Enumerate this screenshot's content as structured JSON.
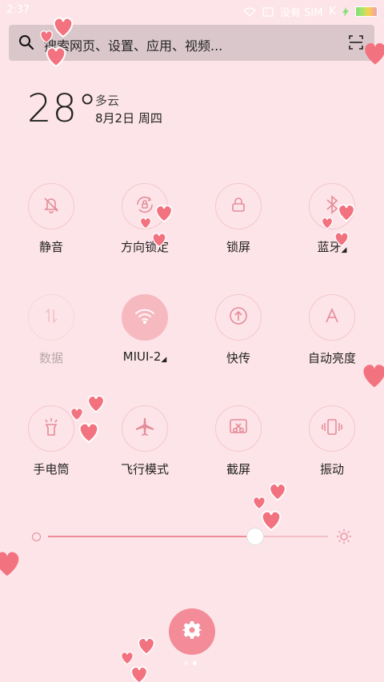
{
  "status_bar": {
    "time": "2:37",
    "carrier": "没有 SIM",
    "speed": "K"
  },
  "search": {
    "placeholder": "搜索网页、设置、应用、视频..."
  },
  "weather": {
    "temperature": "28°",
    "condition": "多云",
    "date": "8月2日 周四"
  },
  "toggles": [
    {
      "label": "静音",
      "icon": "bell-off-icon",
      "state": "off"
    },
    {
      "label": "方向锁定",
      "icon": "rotation-lock-icon",
      "state": "off"
    },
    {
      "label": "锁屏",
      "icon": "lock-icon",
      "state": "off"
    },
    {
      "label": "蓝牙",
      "icon": "bluetooth-icon",
      "state": "off",
      "has_more": true
    },
    {
      "label": "数据",
      "icon": "mobile-data-icon",
      "state": "disabled"
    },
    {
      "label": "MIUI-2",
      "icon": "wifi-icon",
      "state": "on",
      "has_more": true
    },
    {
      "label": "快传",
      "icon": "transfer-icon",
      "state": "off"
    },
    {
      "label": "自动亮度",
      "icon": "auto-brightness-icon",
      "state": "off"
    },
    {
      "label": "手电筒",
      "icon": "flashlight-icon",
      "state": "off"
    },
    {
      "label": "飞行模式",
      "icon": "airplane-icon",
      "state": "off"
    },
    {
      "label": "截屏",
      "icon": "screenshot-icon",
      "state": "off"
    },
    {
      "label": "振动",
      "icon": "vibrate-icon",
      "state": "off"
    }
  ],
  "brightness": {
    "level": 0.74
  },
  "colors": {
    "background": "#fde4e8",
    "accent": "#f38c98",
    "active_toggle": "#f7b9c0",
    "icon": "#e48c98"
  },
  "pages": {
    "count": 2,
    "current": 2
  }
}
